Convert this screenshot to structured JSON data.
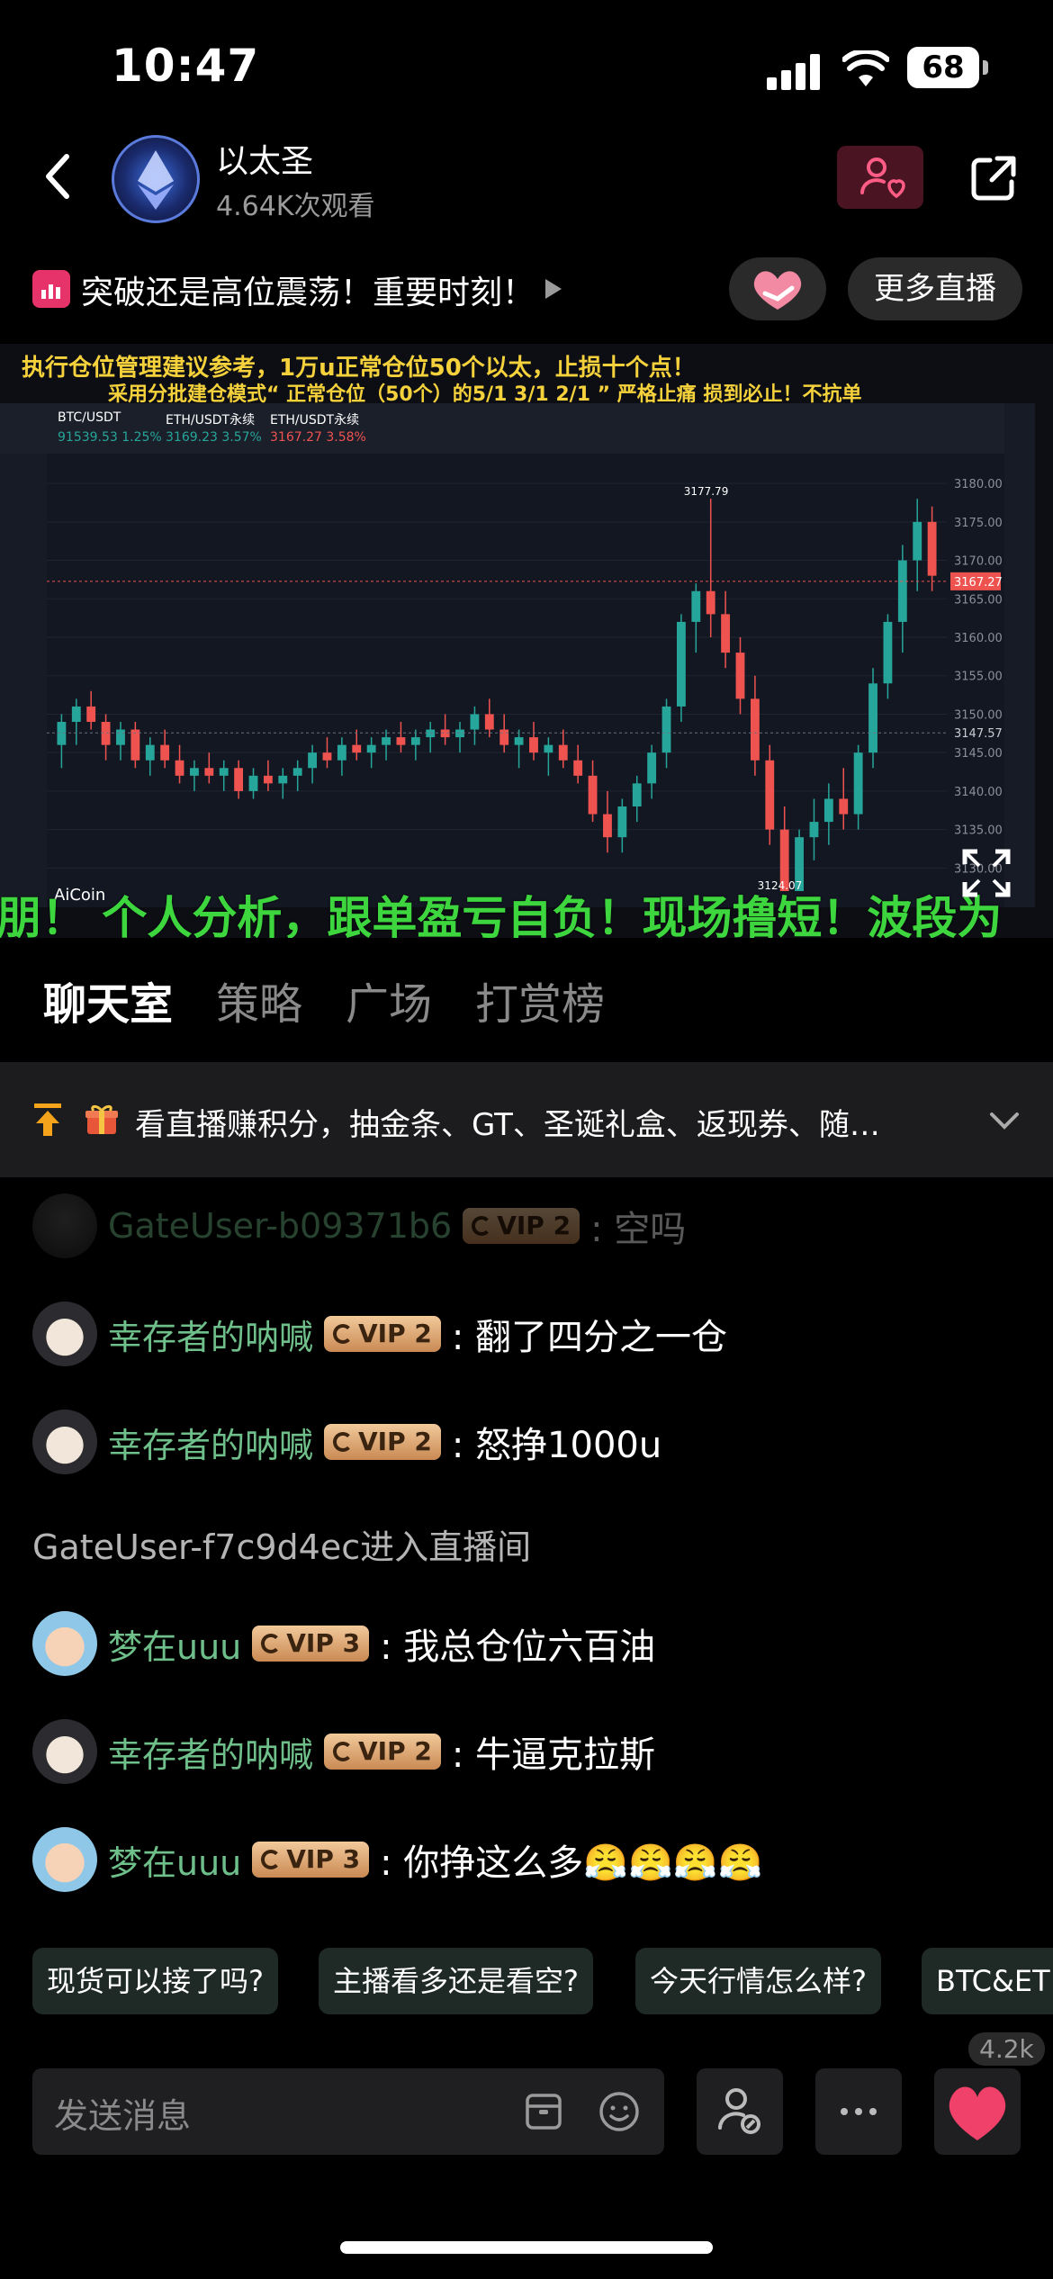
{
  "status": {
    "time": "10:47",
    "battery": "68"
  },
  "header": {
    "title": "以太圣",
    "views": "4.64K次观看"
  },
  "promo": {
    "text": "突破还是高位震荡！重要时刻！",
    "more_live": "更多直播"
  },
  "video": {
    "banner_line1": "执行仓位管理建议参考，1万u正常仓位50个以太，止损十个点！",
    "banner_line2": "采用分批建仓模式“ 正常仓位（50个）的5/1   3/1   2/1 ” 严格止痛 损到必止！不抗单",
    "scroll_text": "朋！ 个人分析，跟单盈亏自负！现场撸短！波段为",
    "watermark": "AiCoin",
    "chart_tabs": [
      "BTC/USDT",
      "ETH/USDT永续",
      "ETH/USDT永续"
    ],
    "chart_prices": [
      "91539.53 1.25%",
      "3169.23 3.57%",
      "3167.27 3.58%"
    ]
  },
  "chart_data": {
    "type": "candlestick",
    "symbol": "ETH/USDT永续",
    "high_label": "3177.79",
    "low_label": "3124.07",
    "last_price": "3167.27",
    "ref_price": "3147.57",
    "y_ticks": [
      "3180.00",
      "3175.00",
      "3170.00",
      "3165.00",
      "3160.00",
      "3155.00",
      "3150.00",
      "3145.00",
      "3140.00",
      "3135.00",
      "3130.00"
    ],
    "ylim": [
      3127,
      3182
    ],
    "ohlc": [
      [
        3146,
        3150,
        3143,
        3149
      ],
      [
        3149,
        3152,
        3146,
        3151
      ],
      [
        3151,
        3153,
        3148,
        3149
      ],
      [
        3149,
        3150,
        3144,
        3146
      ],
      [
        3146,
        3149,
        3144,
        3148
      ],
      [
        3148,
        3149,
        3143,
        3144
      ],
      [
        3144,
        3147,
        3142,
        3146
      ],
      [
        3146,
        3148,
        3143,
        3144
      ],
      [
        3144,
        3146,
        3141,
        3142
      ],
      [
        3142,
        3144,
        3140,
        3143
      ],
      [
        3143,
        3145,
        3141,
        3142
      ],
      [
        3142,
        3144,
        3140,
        3143
      ],
      [
        3143,
        3144,
        3139,
        3140
      ],
      [
        3140,
        3143,
        3139,
        3142
      ],
      [
        3142,
        3144,
        3140,
        3141
      ],
      [
        3141,
        3143,
        3139,
        3142
      ],
      [
        3142,
        3144,
        3140,
        3143
      ],
      [
        3143,
        3146,
        3141,
        3145
      ],
      [
        3145,
        3147,
        3143,
        3144
      ],
      [
        3144,
        3147,
        3142,
        3146
      ],
      [
        3146,
        3148,
        3144,
        3145
      ],
      [
        3145,
        3147,
        3143,
        3146
      ],
      [
        3146,
        3148,
        3144,
        3147
      ],
      [
        3147,
        3149,
        3145,
        3146
      ],
      [
        3146,
        3148,
        3144,
        3147
      ],
      [
        3147,
        3149,
        3145,
        3148
      ],
      [
        3148,
        3150,
        3146,
        3147
      ],
      [
        3147,
        3149,
        3145,
        3148
      ],
      [
        3148,
        3151,
        3146,
        3150
      ],
      [
        3150,
        3152,
        3147,
        3148
      ],
      [
        3148,
        3150,
        3145,
        3146
      ],
      [
        3146,
        3148,
        3143,
        3147
      ],
      [
        3147,
        3149,
        3144,
        3145
      ],
      [
        3145,
        3147,
        3142,
        3146
      ],
      [
        3146,
        3148,
        3143,
        3144
      ],
      [
        3144,
        3146,
        3141,
        3142
      ],
      [
        3142,
        3144,
        3136,
        3137
      ],
      [
        3137,
        3140,
        3132,
        3134
      ],
      [
        3134,
        3139,
        3132,
        3138
      ],
      [
        3138,
        3142,
        3136,
        3141
      ],
      [
        3141,
        3146,
        3139,
        3145
      ],
      [
        3145,
        3152,
        3143,
        3151
      ],
      [
        3151,
        3163,
        3149,
        3162
      ],
      [
        3162,
        3167,
        3158,
        3166
      ],
      [
        3166,
        3178,
        3160,
        3163
      ],
      [
        3163,
        3166,
        3156,
        3158
      ],
      [
        3158,
        3160,
        3150,
        3152
      ],
      [
        3152,
        3155,
        3142,
        3144
      ],
      [
        3144,
        3146,
        3133,
        3135
      ],
      [
        3135,
        3138,
        3124,
        3127
      ],
      [
        3127,
        3135,
        3126,
        3134
      ],
      [
        3134,
        3139,
        3131,
        3136
      ],
      [
        3136,
        3141,
        3133,
        3139
      ],
      [
        3139,
        3143,
        3135,
        3137
      ],
      [
        3137,
        3146,
        3135,
        3145
      ],
      [
        3145,
        3156,
        3143,
        3154
      ],
      [
        3154,
        3163,
        3152,
        3162
      ],
      [
        3162,
        3172,
        3158,
        3170
      ],
      [
        3170,
        3178,
        3166,
        3175
      ],
      [
        3175,
        3177,
        3166,
        3168
      ]
    ]
  },
  "tabs": [
    "聊天室",
    "策略",
    "广场",
    "打赏榜"
  ],
  "notice": {
    "text": "看直播赚积分，抽金条、GT、圣诞礼盒、返现券、随…"
  },
  "chat": [
    {
      "type": "msg",
      "user": "GateUser-b09371b6",
      "vip": "VIP 2",
      "text": ": 空吗",
      "avatar": "dark",
      "faded": true
    },
    {
      "type": "msg",
      "user": "幸存者的呐喊",
      "vip": "VIP 2",
      "text": ": 翻了四分之一仓",
      "avatar": "anime"
    },
    {
      "type": "msg",
      "user": "幸存者的呐喊",
      "vip": "VIP 2",
      "text": ": 怒挣1000u",
      "avatar": "anime"
    },
    {
      "type": "sys",
      "text": "GateUser-f7c9d4ec进入直播间"
    },
    {
      "type": "msg",
      "user": "梦在uuu",
      "vip": "VIP 3",
      "text": ": 我总仓位六百油",
      "avatar": "cartoon"
    },
    {
      "type": "msg",
      "user": "幸存者的呐喊",
      "vip": "VIP 2",
      "text": ": 牛逼克拉斯",
      "avatar": "anime"
    },
    {
      "type": "msg",
      "user": "梦在uuu",
      "vip": "VIP 3",
      "text": ": 你挣这么多😤😤😤😤",
      "avatar": "cartoon"
    }
  ],
  "quick_chips": [
    "现货可以接了吗?",
    "主播看多还是看空?",
    "今天行情怎么样?",
    "BTC&ET"
  ],
  "bottom": {
    "placeholder": "发送消息",
    "like_count": "4.2k"
  },
  "colors": {
    "accent_green": "#6fbf8a",
    "bull": "#26a69a",
    "bear": "#ef5350",
    "vip_gold": "#e2b07a",
    "heart": "#f0416a"
  }
}
